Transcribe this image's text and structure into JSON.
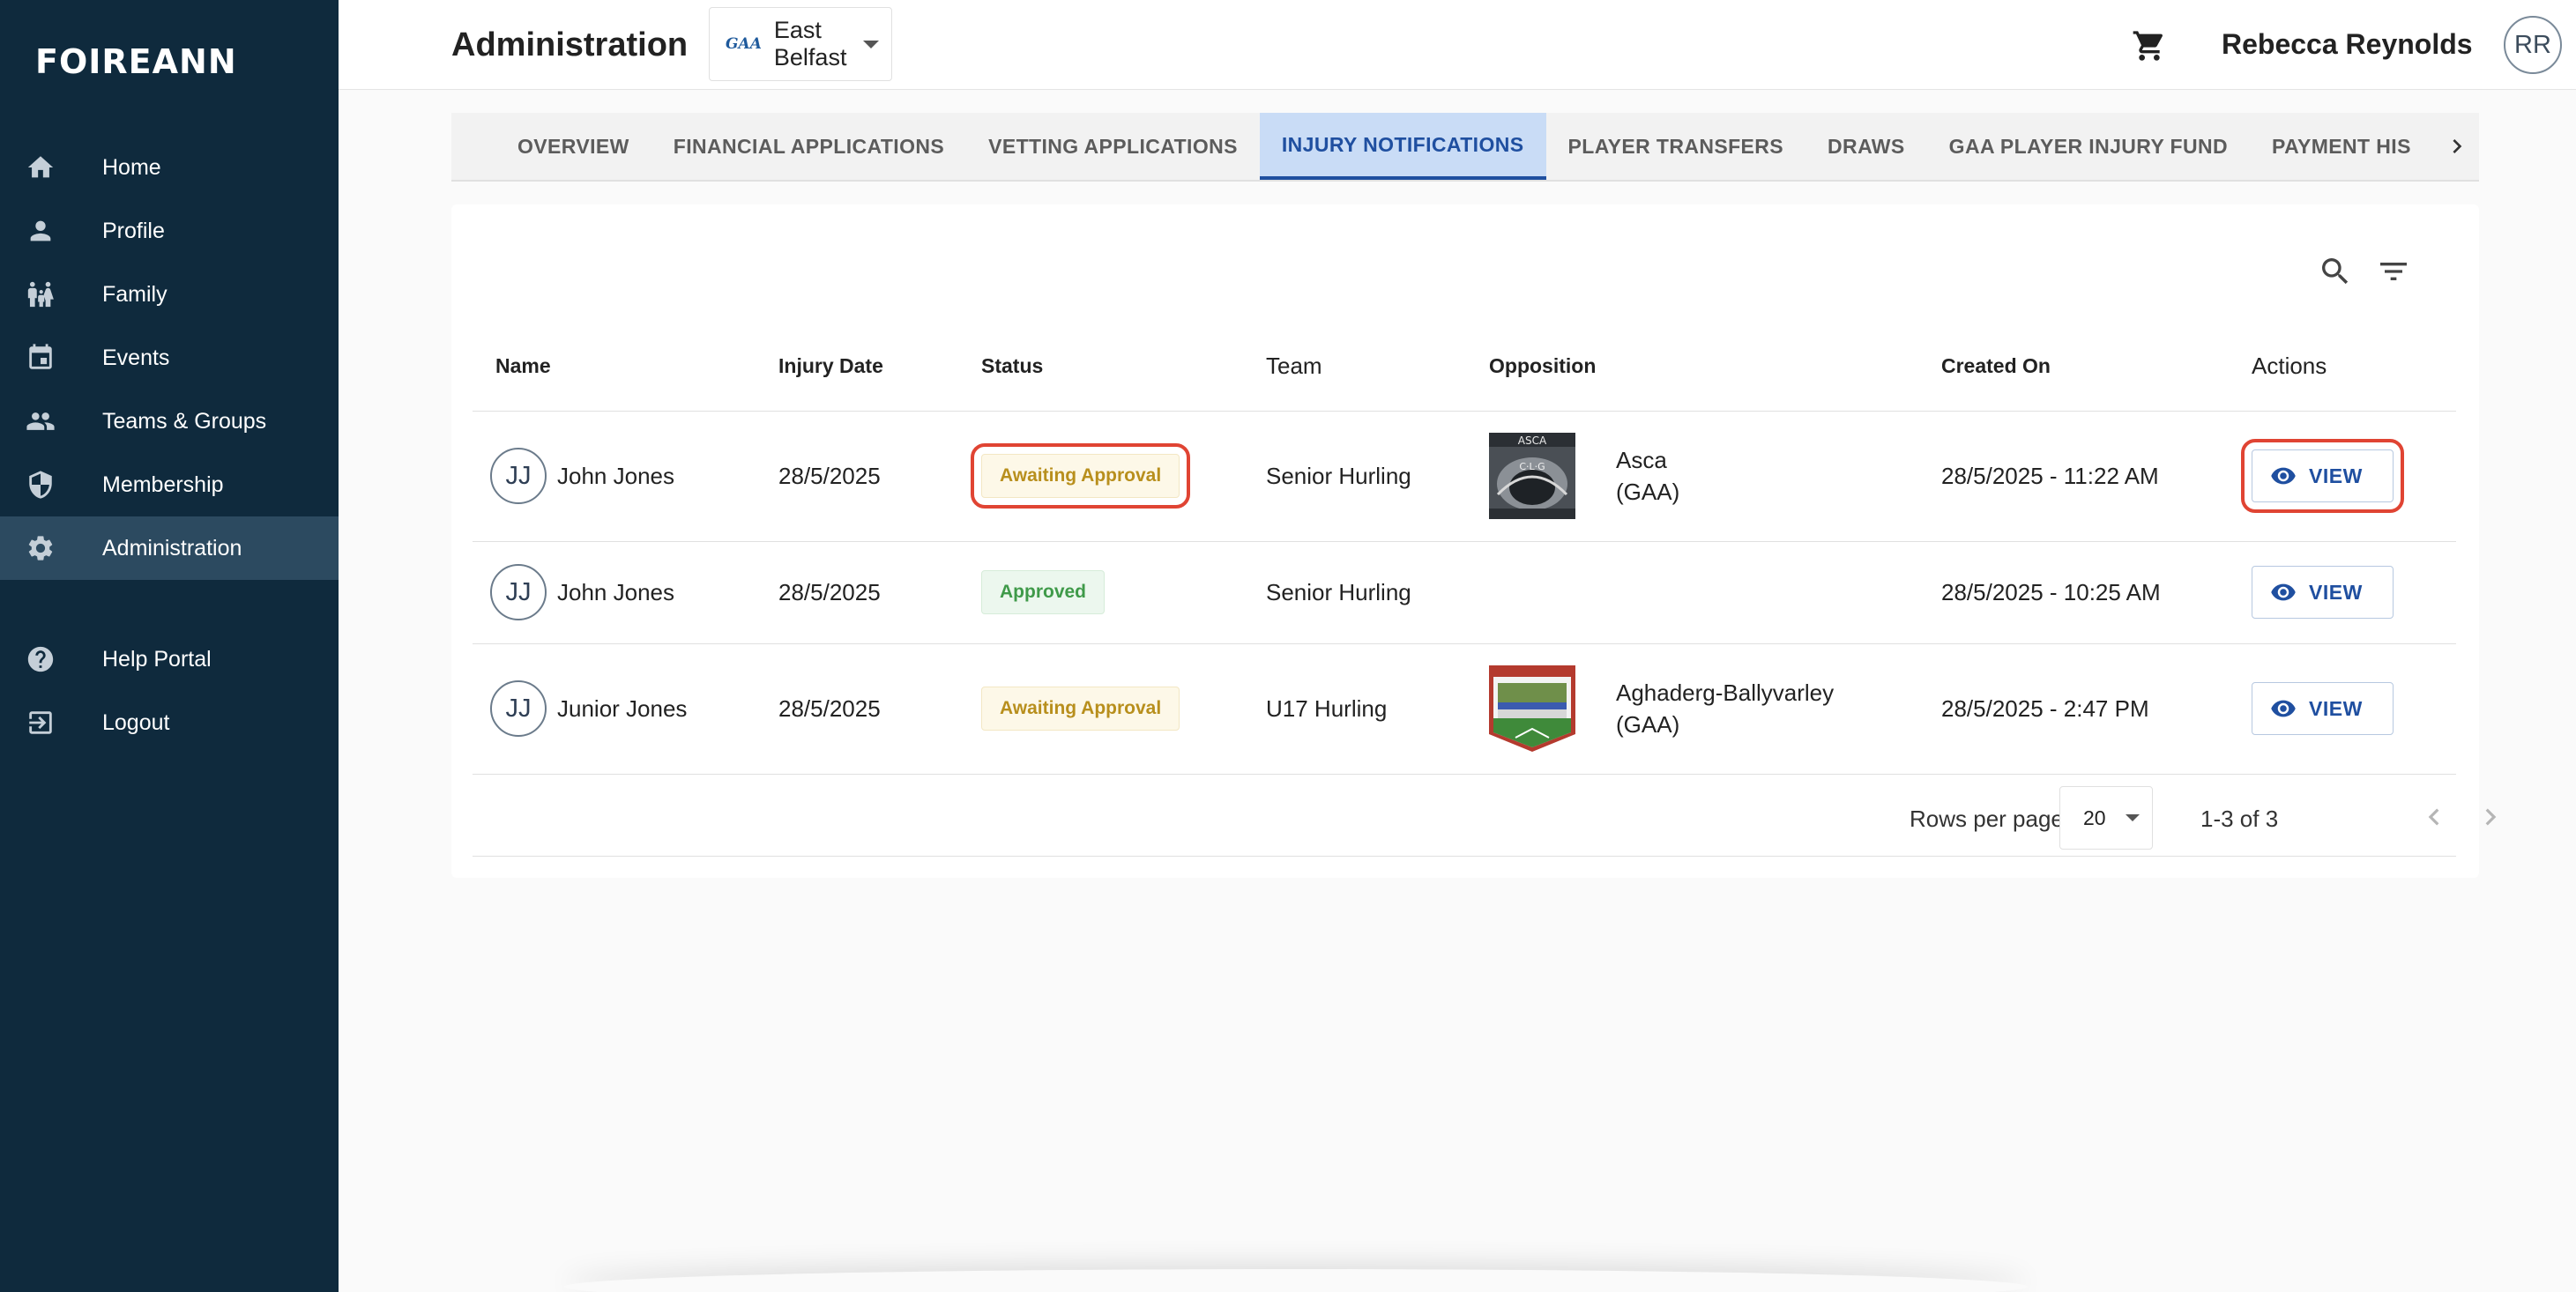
{
  "sidebar": {
    "logo": "FOIREANN",
    "items": [
      {
        "label": "Home",
        "icon": "home-icon"
      },
      {
        "label": "Profile",
        "icon": "person-icon"
      },
      {
        "label": "Family",
        "icon": "family-icon"
      },
      {
        "label": "Events",
        "icon": "calendar-icon"
      },
      {
        "label": "Teams & Groups",
        "icon": "groups-icon"
      },
      {
        "label": "Membership",
        "icon": "shield-icon"
      },
      {
        "label": "Administration",
        "icon": "gear-icon",
        "active": true
      }
    ],
    "bottom_items": [
      {
        "label": "Help Portal",
        "icon": "help-icon"
      },
      {
        "label": "Logout",
        "icon": "logout-icon"
      }
    ]
  },
  "header": {
    "title": "Administration",
    "club_logo_text": "GAA",
    "club": "East Belfast",
    "user_name": "Rebecca Reynolds",
    "user_initials": "RR"
  },
  "tabs": [
    {
      "label": "OVERVIEW"
    },
    {
      "label": "FINANCIAL APPLICATIONS"
    },
    {
      "label": "VETTING APPLICATIONS"
    },
    {
      "label": "INJURY NOTIFICATIONS",
      "active": true
    },
    {
      "label": "PLAYER TRANSFERS"
    },
    {
      "label": "DRAWS"
    },
    {
      "label": "GAA PLAYER INJURY FUND"
    },
    {
      "label": "PAYMENT HIS"
    }
  ],
  "table": {
    "columns": [
      "Name",
      "Injury Date",
      "Status",
      "Team",
      "Opposition",
      "Created On",
      "Actions"
    ],
    "rows": [
      {
        "initials": "JJ",
        "name": "John Jones",
        "injury_date": "28/5/2025",
        "status": "Awaiting Approval",
        "team": "Senior Hurling",
        "opposition_line1": "Asca",
        "opposition_line2": "(GAA)",
        "created_on": "28/5/2025 - 11:22 AM",
        "action": "VIEW"
      },
      {
        "initials": "JJ",
        "name": "John Jones",
        "injury_date": "28/5/2025",
        "status": "Approved",
        "team": "Senior Hurling",
        "opposition_line1": "",
        "opposition_line2": "",
        "created_on": "28/5/2025 - 10:25 AM",
        "action": "VIEW"
      },
      {
        "initials": "JJ",
        "name": "Junior Jones",
        "injury_date": "28/5/2025",
        "status": "Awaiting Approval",
        "team": "U17 Hurling",
        "opposition_line1": "Aghaderg-Ballyvarley",
        "opposition_line2": "(GAA)",
        "created_on": "28/5/2025 - 2:47 PM",
        "action": "VIEW"
      }
    ]
  },
  "pagination": {
    "rows_per_page_label": "Rows per page:",
    "rows_per_page": "20",
    "range": "1-3 of 3"
  },
  "colors": {
    "sidebar_bg": "#0f2a3d",
    "accent": "#1f4fa0",
    "highlight": "#e04433"
  }
}
